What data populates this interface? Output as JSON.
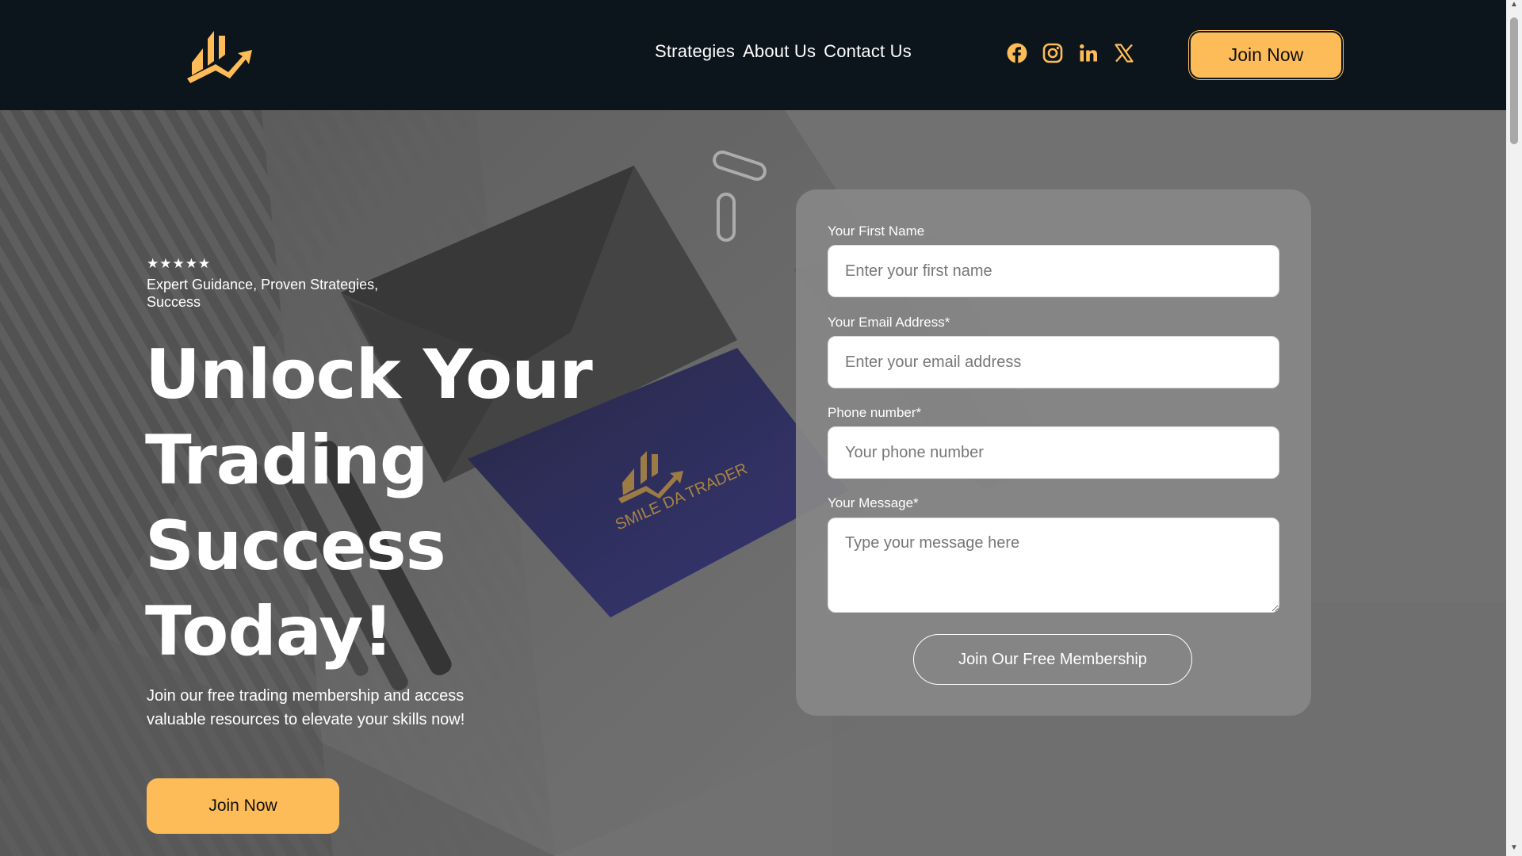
{
  "colors": {
    "header_bg": "#0c141c",
    "accent": "#fdbc57",
    "hero_overlay": "#6e6e6e",
    "card_bg": "#878787"
  },
  "header": {
    "logo_icon": "trading-chart-logo",
    "nav": [
      "Strategies",
      "About Us",
      "Contact Us"
    ],
    "socials": [
      "facebook-icon",
      "instagram-icon",
      "linkedin-icon",
      "x-icon"
    ],
    "join_label": "Join Now"
  },
  "hero": {
    "rating": "★★★★★",
    "tagline": "Expert Guidance, Proven Strategies, Success",
    "headline": "Unlock Your Trading Success Today!",
    "subtext": "Join our free trading membership and access valuable resources to elevate your skills now!",
    "join_label": "Join Now",
    "card_brand": "SMILE DA TRADER"
  },
  "form": {
    "first_name_label": "Your First Name",
    "first_name_placeholder": "Enter your first name",
    "email_label": "Your Email Address*",
    "email_placeholder": "Enter your email address",
    "phone_label": "Phone number*",
    "phone_placeholder": "Your phone number",
    "message_label": "Your Message*",
    "message_placeholder": "Type your message here",
    "submit_label": "Join Our Free Membership"
  }
}
